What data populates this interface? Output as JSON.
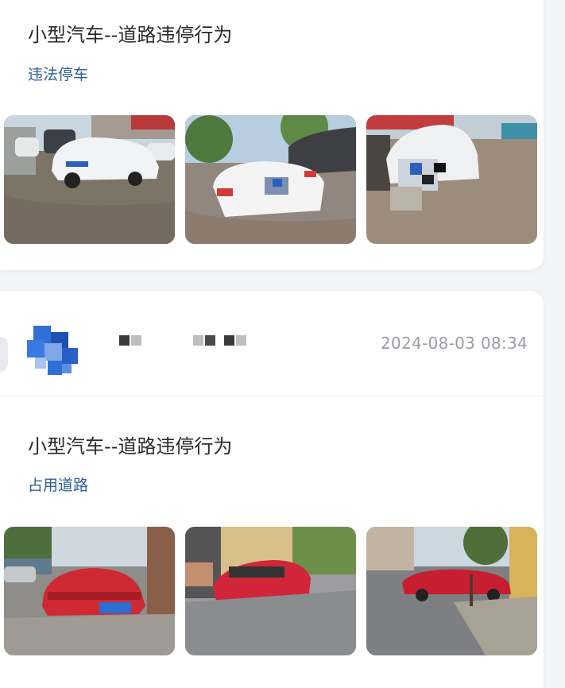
{
  "posts": [
    {
      "title": "小型汽车--道路违停行为",
      "violation": "违法停车",
      "photos": [
        "white-sedan-parked-on-sidewalk-photo",
        "white-sedan-rear-blurred-plate-photo",
        "white-sedan-front-blurred-plate-photo"
      ]
    },
    {
      "date": "2024-08-03 08:34",
      "title": "小型汽车--道路违停行为",
      "violation": "占用道路",
      "photos": [
        "red-sedan-front-blurred-plate-photo",
        "red-sedan-parked-street-photo",
        "red-sedan-side-on-sidewalk-photo"
      ]
    }
  ],
  "colors": {
    "tag": "#2d5f9e",
    "title": "#2a2a2a",
    "date": "#9a9da3",
    "avatar": "#2f6fd6"
  }
}
